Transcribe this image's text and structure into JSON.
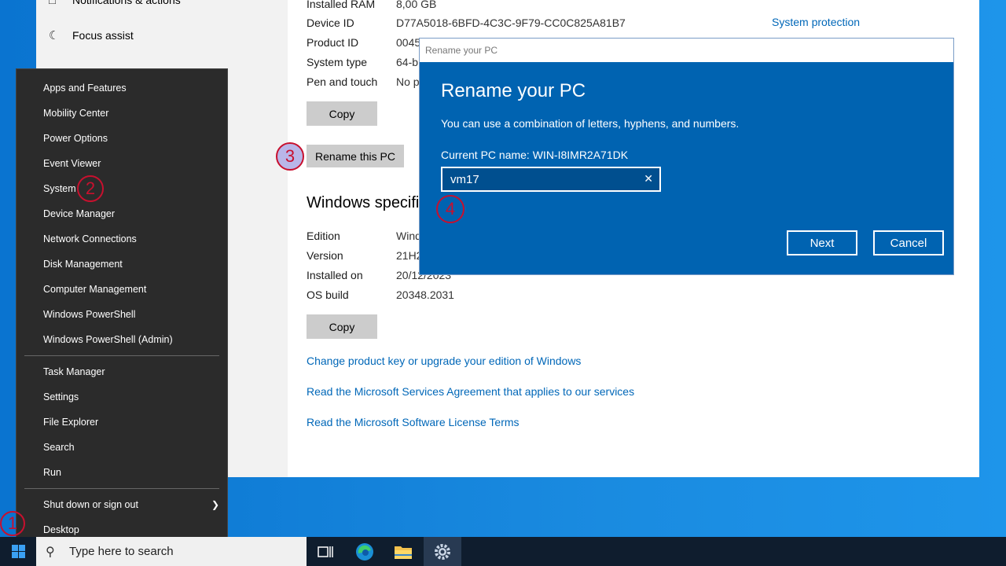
{
  "settings": {
    "nav_items": [
      {
        "label": "Notifications & actions"
      },
      {
        "label": "Focus assist"
      }
    ],
    "device_specs": [
      {
        "key": "Installed RAM",
        "value": "8,00 GB"
      },
      {
        "key": "Device ID",
        "value": "D77A5018-6BFD-4C3C-9F79-CC0C825A81B7"
      },
      {
        "key": "Product ID",
        "value": "0045"
      },
      {
        "key": "System type",
        "value": "64-b"
      },
      {
        "key": "Pen and touch",
        "value": "No p"
      }
    ],
    "system_protection_link": "System protection",
    "copy_label": "Copy",
    "rename_label": "Rename this PC",
    "windows_spec_title": "Windows specifi",
    "windows_specs": [
      {
        "key": "Edition",
        "value": "Windo"
      },
      {
        "key": "Version",
        "value": "21H2"
      },
      {
        "key": "Installed on",
        "value": "20/12/2023"
      },
      {
        "key": "OS build",
        "value": "20348.2031"
      }
    ],
    "links": [
      "Change product key or upgrade your edition of Windows",
      "Read the Microsoft Services Agreement that applies to our services",
      "Read the Microsoft Software License Terms"
    ]
  },
  "dialog": {
    "window_title": "Rename your PC",
    "heading": "Rename your PC",
    "description": "You can use a combination of letters, hyphens, and numbers.",
    "current_name": "Current PC name: WIN-I8IMR2A71DK",
    "input_value": "vm17",
    "next_label": "Next",
    "cancel_label": "Cancel"
  },
  "context_menu": {
    "group1": [
      "Apps and Features",
      "Mobility Center",
      "Power Options",
      "Event Viewer",
      "System",
      "Device Manager",
      "Network Connections",
      "Disk Management",
      "Computer Management",
      "Windows PowerShell",
      "Windows PowerShell (Admin)"
    ],
    "group2": [
      "Task Manager",
      "Settings",
      "File Explorer",
      "Search",
      "Run"
    ],
    "group3": [
      "Shut down or sign out",
      "Desktop"
    ]
  },
  "markers": [
    "1",
    "2",
    "3",
    "4"
  ],
  "taskbar": {
    "search_placeholder": "Type here to search",
    "icons": [
      "task-view-icon",
      "edge-icon",
      "file-explorer-icon",
      "settings-gear-icon"
    ]
  },
  "colors": {
    "accent": "#0078d7",
    "dialog_bg": "#0063b1",
    "marker": "#c8102e",
    "link": "#0067b8"
  }
}
